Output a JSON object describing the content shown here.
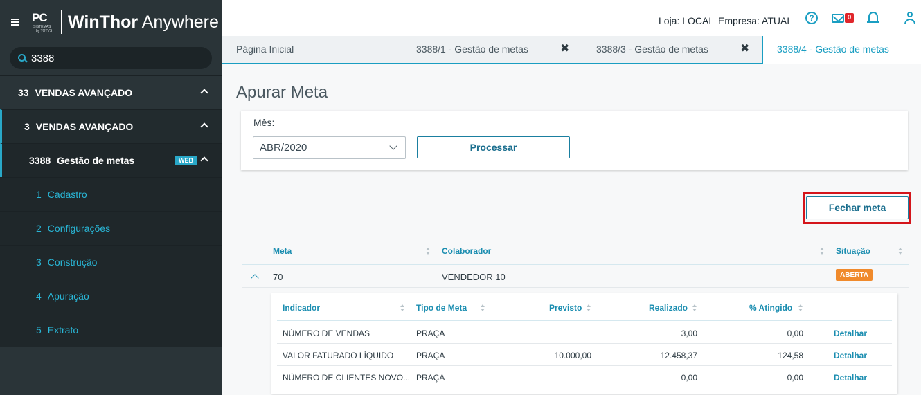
{
  "app": {
    "logo_text": "PC",
    "logo_sub": "SISTEMAS",
    "logo_sub2": "by TOTVS",
    "brand_bold": "WinThor",
    "brand_light": "Anywhere"
  },
  "search": {
    "value": "3388"
  },
  "sidebar": {
    "items": [
      {
        "num": "33",
        "label": "VENDAS AVANÇADO",
        "level": 1,
        "expanded": true
      },
      {
        "num": "3",
        "label": "VENDAS AVANÇADO",
        "level": 2,
        "expanded": true
      },
      {
        "num": "3388",
        "label": "Gestão de metas",
        "level": 3,
        "badge": "WEB",
        "expanded": true
      },
      {
        "num": "1",
        "label": "Cadastro",
        "level": 4
      },
      {
        "num": "2",
        "label": "Configurações",
        "level": 4
      },
      {
        "num": "3",
        "label": "Construção",
        "level": 4
      },
      {
        "num": "4",
        "label": "Apuração",
        "level": 4
      },
      {
        "num": "5",
        "label": "Extrato",
        "level": 4
      }
    ]
  },
  "topbar": {
    "loja": "Loja: LOCAL",
    "empresa": "Empresa: ATUAL",
    "help_icon": "?",
    "mail_count": "0"
  },
  "tabs": [
    {
      "label": "Página Inicial",
      "closable": false,
      "active": false
    },
    {
      "label": "3388/1 - Gestão de metas",
      "closable": true,
      "active": false
    },
    {
      "label": "3388/3 - Gestão de metas",
      "closable": true,
      "active": false
    },
    {
      "label": "3388/4 - Gestão de metas",
      "closable": false,
      "active": true
    }
  ],
  "tab_close_glyph": "✖",
  "page": {
    "title": "Apurar Meta",
    "mes_label": "Mês:",
    "mes_value": "ABR/2020",
    "process_button": "Processar",
    "close_goal_button": "Fechar meta"
  },
  "main_table": {
    "headers": [
      "Meta",
      "Colaborador",
      "Situação"
    ],
    "rows": [
      {
        "meta": "70",
        "colaborador": "VENDEDOR 10",
        "situacao": "ABERTA"
      }
    ]
  },
  "sub_table": {
    "headers": [
      "Indicador",
      "Tipo de Meta",
      "Previsto",
      "Realizado",
      "% Atingido"
    ],
    "rows": [
      {
        "indicador": "NÚMERO DE VENDAS",
        "tipo": "PRAÇA",
        "previsto": "",
        "realizado": "3,00",
        "atingido": "0,00",
        "acao": "Detalhar"
      },
      {
        "indicador": "VALOR FATURADO LÍQUIDO",
        "tipo": "PRAÇA",
        "previsto": "10.000,00",
        "realizado": "12.458,37",
        "atingido": "124,58",
        "acao": "Detalhar"
      },
      {
        "indicador": "NÚMERO DE CLIENTES NOVO...",
        "tipo": "PRAÇA",
        "previsto": "",
        "realizado": "0,00",
        "atingido": "0,00",
        "acao": "Detalhar"
      }
    ]
  },
  "colors": {
    "accent": "#1a9ec2",
    "sidebar_bg": "#2a3438",
    "status_open": "#f08a2c",
    "highlight_frame": "#d4151b",
    "mail_badge": "#e0262b"
  }
}
